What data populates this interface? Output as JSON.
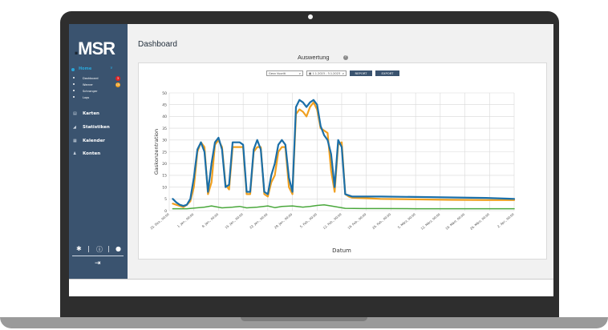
{
  "sidebar": {
    "logo_main": "MSR",
    "logo_dot": ".",
    "active_item": {
      "label": "Home",
      "chevron": "∨",
      "icon": "circle-dot-icon"
    },
    "sub_items": [
      {
        "label": "Dashboard",
        "badge": "3",
        "badge_color": "#e02424"
      },
      {
        "label": "Warner",
        "badge": "15",
        "badge_color": "#f2a020"
      },
      {
        "label": "Schranger",
        "badge": "",
        "badge_color": ""
      },
      {
        "label": "Logs",
        "badge": "",
        "badge_color": ""
      }
    ],
    "items": [
      {
        "label": "Karten",
        "icon": "map-icon"
      },
      {
        "label": "Statistiken",
        "icon": "chart-icon"
      },
      {
        "label": "Kalender",
        "icon": "calendar-icon"
      },
      {
        "label": "Konten",
        "icon": "users-icon"
      }
    ],
    "footer_icons": [
      "gear-icon",
      "info-icon",
      "moon-icon",
      "logout-icon"
    ]
  },
  "main": {
    "title": "Dashboard",
    "section_title": "Auswertung",
    "controls": {
      "sensor_select": "Gesn Vuoriti",
      "date_range": "1.1.2023 - 3.1.2023",
      "report_button": "REPORT",
      "export_button": "EXPORT"
    }
  },
  "colors": {
    "sidebar_bg": "#3a536f",
    "accent": "#2aa6d9",
    "series_blue": "#1b6fa8",
    "series_orange": "#f0a020",
    "series_green": "#4aa83c"
  },
  "chart_data": {
    "type": "line",
    "xlabel": "Datum",
    "ylabel": "Gaskonzentration",
    "ylim": [
      0,
      50
    ],
    "yticks": [
      0,
      5,
      10,
      15,
      20,
      25,
      30,
      35,
      40,
      45,
      50
    ],
    "x_tick_labels": [
      "25. Dez., 00:00",
      "1. Jan., 00:00",
      "8. Jan., 00:00",
      "15. Jan., 00:00",
      "22. Jan., 00:00",
      "29. Jan., 00:00",
      "5. Feb., 00:00",
      "12. Feb., 00:00",
      "19. Feb., 00:00",
      "26. Feb., 00:00",
      "5. März, 00:00",
      "12. März, 00:00",
      "19. März, 00:00",
      "26. März, 00:00",
      "2. Apr., 00:00"
    ],
    "grid": true,
    "series": [
      {
        "color": "#1b6fa8",
        "x": [
          1,
          2,
          3,
          4,
          5,
          6,
          7,
          8,
          9,
          10,
          11,
          12,
          13,
          14,
          15,
          16,
          17,
          18,
          19,
          20,
          21,
          22,
          23,
          24,
          25,
          26,
          27,
          28,
          29,
          30,
          31,
          32,
          33,
          34,
          35,
          36,
          37,
          38,
          39,
          40,
          41,
          42,
          43,
          44,
          45,
          46,
          47,
          48,
          49,
          50,
          51,
          52,
          55,
          60,
          70,
          80,
          90,
          98
        ],
        "y": [
          5,
          3.5,
          2.5,
          2,
          2.5,
          5,
          14,
          26,
          29,
          25,
          8,
          20,
          29,
          31,
          26,
          10,
          11,
          29,
          29,
          29,
          28,
          8,
          8,
          26,
          30,
          26,
          8,
          7,
          15,
          20,
          28,
          30,
          28,
          14,
          8,
          44,
          47,
          46,
          44,
          46,
          47,
          45,
          36,
          32,
          30,
          24,
          10,
          30,
          27,
          7,
          6.5,
          6,
          6,
          6,
          5.8,
          5.6,
          5.4,
          5
        ]
      },
      {
        "color": "#f0a020",
        "x": [
          1,
          2,
          3,
          4,
          5,
          6,
          7,
          8,
          9,
          10,
          11,
          12,
          13,
          14,
          15,
          16,
          17,
          18,
          19,
          20,
          21,
          22,
          23,
          24,
          25,
          26,
          27,
          28,
          29,
          30,
          31,
          32,
          33,
          34,
          35,
          36,
          37,
          38,
          39,
          40,
          41,
          42,
          43,
          44,
          45,
          46,
          47,
          48,
          49,
          50,
          51,
          52,
          55,
          60,
          70,
          80,
          90,
          98
        ],
        "y": [
          3,
          2.5,
          2,
          1.5,
          2.5,
          4,
          10,
          25,
          29,
          27,
          7,
          12,
          28,
          30,
          27,
          11,
          9,
          27,
          27,
          27,
          27,
          7,
          7,
          25,
          27,
          27,
          7,
          6,
          12,
          15,
          25,
          27,
          27,
          10,
          7,
          41,
          43,
          42,
          40,
          44,
          46,
          43,
          35,
          34,
          33,
          17,
          8,
          28,
          29,
          7,
          6,
          5.5,
          5.3,
          5,
          4.8,
          4.6,
          4.5,
          4.5
        ]
      },
      {
        "color": "#4aa83c",
        "x": [
          1,
          5,
          10,
          12,
          15,
          18,
          20,
          22,
          25,
          28,
          30,
          32,
          35,
          38,
          40,
          42,
          44,
          46,
          48,
          50,
          55,
          60,
          70,
          80,
          90,
          98
        ],
        "y": [
          0.8,
          0.8,
          1.5,
          2,
          1.2,
          1.5,
          1.8,
          1.2,
          1.5,
          2,
          1.3,
          1.8,
          2,
          1.5,
          1.8,
          2.2,
          2.5,
          2,
          1.5,
          1,
          0.9,
          0.9,
          0.8,
          0.8,
          0.8,
          0.8
        ]
      }
    ],
    "x_range": [
      0,
      98
    ]
  }
}
